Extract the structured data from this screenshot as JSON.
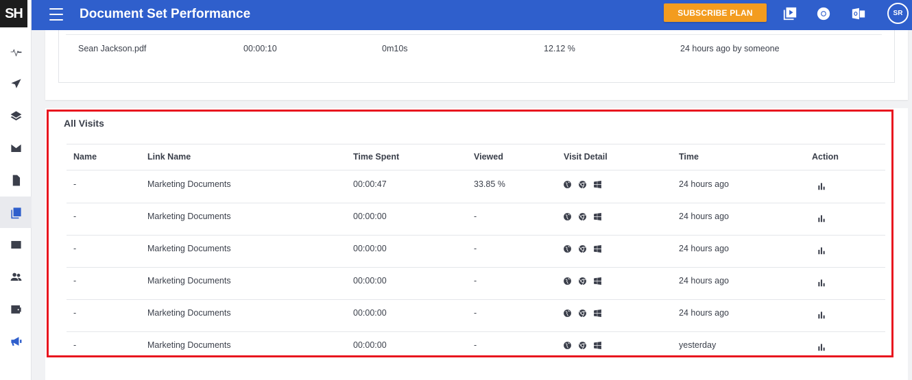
{
  "app": {
    "logo": "SH"
  },
  "header": {
    "title": "Document Set Performance",
    "subscribe_label": "SUBSCRIBE PLAN",
    "avatar_initials": "SR",
    "accent": "#2f5fcc",
    "subscribe_color": "#f39c1f"
  },
  "documents": {
    "row": {
      "name": "Sean Jackson.pdf",
      "time_spent": "00:00:10",
      "duration": "0m10s",
      "viewed": "12.12 %",
      "updated": "24 hours ago by someone"
    }
  },
  "visits": {
    "title": "All Visits",
    "columns": [
      "Name",
      "Link Name",
      "Time Spent",
      "Viewed",
      "Visit Detail",
      "Time",
      "Action"
    ],
    "rows": [
      {
        "name": "-",
        "link_name": "Marketing Documents",
        "time_spent": "00:00:47",
        "viewed": "33.85 %",
        "time": "24 hours ago"
      },
      {
        "name": "-",
        "link_name": "Marketing Documents",
        "time_spent": "00:00:00",
        "viewed": "-",
        "time": "24 hours ago"
      },
      {
        "name": "-",
        "link_name": "Marketing Documents",
        "time_spent": "00:00:00",
        "viewed": "-",
        "time": "24 hours ago"
      },
      {
        "name": "-",
        "link_name": "Marketing Documents",
        "time_spent": "00:00:00",
        "viewed": "-",
        "time": "24 hours ago"
      },
      {
        "name": "-",
        "link_name": "Marketing Documents",
        "time_spent": "00:00:00",
        "viewed": "-",
        "time": "24 hours ago"
      },
      {
        "name": "-",
        "link_name": "Marketing Documents",
        "time_spent": "00:00:00",
        "viewed": "-",
        "time": "yesterday"
      }
    ],
    "visit_detail_icons": [
      "globe-icon",
      "chrome-icon",
      "windows-icon"
    ],
    "action_icon": "bar-chart-icon",
    "highlight_color": "#e8151e"
  },
  "sidebar": {
    "items": [
      "activity-icon",
      "send-icon",
      "layers-icon",
      "mail-icon",
      "document-icon",
      "document-set-icon",
      "mail-icon",
      "people-icon",
      "wallet-icon",
      "megaphone-icon"
    ],
    "active_item": "document-set-icon"
  }
}
